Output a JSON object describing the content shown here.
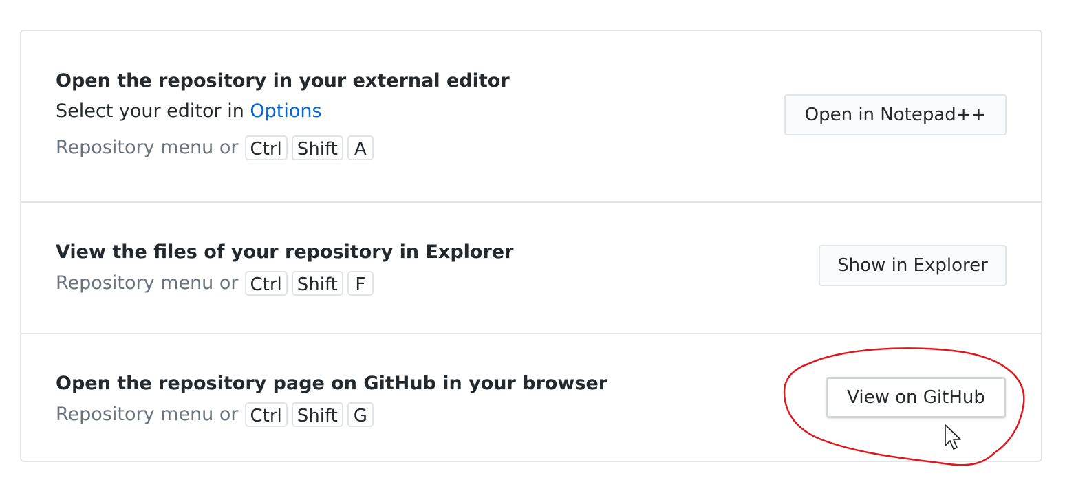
{
  "sections": {
    "editor": {
      "title": "Open the repository in your external editor",
      "description_prefix": "Select your editor in ",
      "options_link": "Options",
      "shortcut_prefix": "Repository menu or",
      "keys": [
        "Ctrl",
        "Shift",
        "A"
      ],
      "button_label": "Open in Notepad++"
    },
    "explorer": {
      "title": "View the files of your repository in Explorer",
      "shortcut_prefix": "Repository menu or",
      "keys": [
        "Ctrl",
        "Shift",
        "F"
      ],
      "button_label": "Show in Explorer"
    },
    "github": {
      "title": "Open the repository page on GitHub in your browser",
      "shortcut_prefix": "Repository menu or",
      "keys": [
        "Ctrl",
        "Shift",
        "G"
      ],
      "button_label": "View on GitHub"
    }
  },
  "colors": {
    "link": "#0366d6",
    "annotation": "#e0161d",
    "border": "#e1e4e8",
    "muted_text": "#6a737d"
  },
  "icons": {
    "cursor": "mouse-pointer-icon"
  }
}
